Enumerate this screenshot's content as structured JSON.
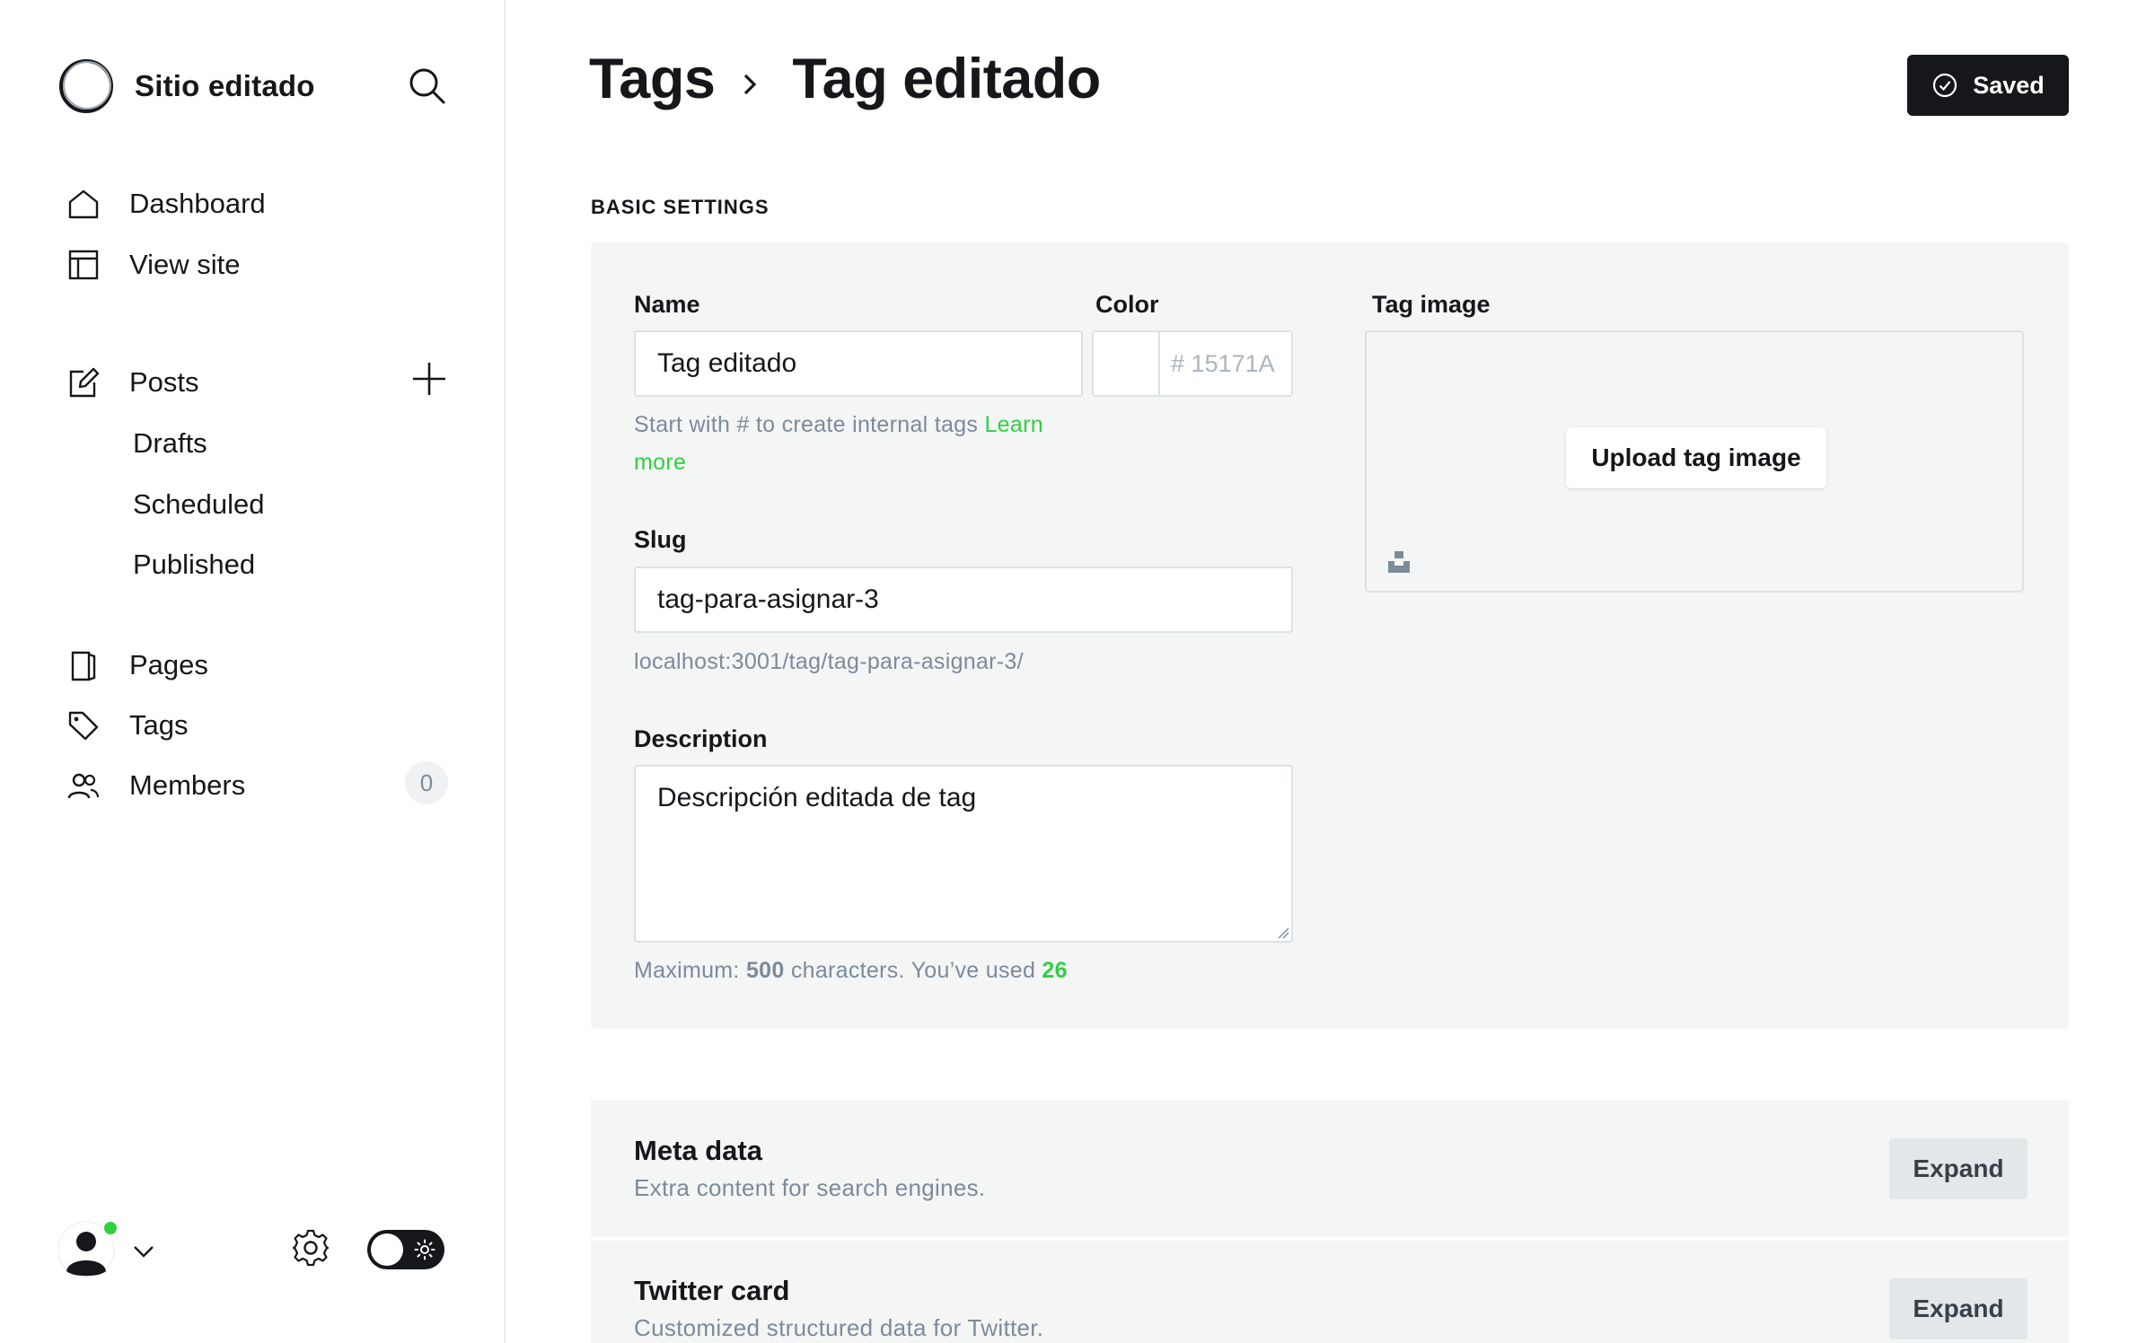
{
  "sidebar": {
    "site_title": "Sitio editado",
    "nav": {
      "dashboard": "Dashboard",
      "view_site": "View site",
      "posts": "Posts",
      "drafts": "Drafts",
      "scheduled": "Scheduled",
      "published": "Published",
      "pages": "Pages",
      "tags": "Tags",
      "members": "Members",
      "members_count": "0"
    },
    "icons": [
      "search-icon",
      "home-icon",
      "layout-icon",
      "edit-icon",
      "plus-icon",
      "page-icon",
      "tag-icon",
      "members-icon",
      "avatar-icon",
      "chevron-down-icon",
      "gear-icon",
      "sun-icon"
    ],
    "status_color": "#30cf43"
  },
  "header": {
    "breadcrumb_parent": "Tags",
    "title": "Tag editado",
    "saved_label": "Saved"
  },
  "form": {
    "section_label": "Basic settings",
    "name_label": "Name",
    "name_value": "Tag editado",
    "name_help": "Start with # to create internal tags",
    "name_help_link": "Learn more",
    "color_label": "Color",
    "color_hash": "#",
    "color_placeholder": "15171A",
    "slug_label": "Slug",
    "slug_value": "tag-para-asignar-3",
    "slug_url": "localhost:3001/tag/tag-para-asignar-3/",
    "description_label": "Description",
    "description_value": "Descripción editada de tag",
    "desc_help_prefix": "Maximum:",
    "desc_help_max": "500",
    "desc_help_middle": "characters. You’ve used",
    "desc_help_used": "26",
    "tag_image_label": "Tag image",
    "upload_label": "Upload tag image"
  },
  "sections": [
    {
      "title": "Meta data",
      "subtitle": "Extra content for search engines.",
      "button": "Expand"
    },
    {
      "title": "Twitter card",
      "subtitle": "Customized structured data for Twitter.",
      "button": "Expand"
    }
  ],
  "colors": {
    "accent_green": "#30cf43",
    "primary_dark": "#15171a",
    "muted_text": "#7c8b9a",
    "panel_bg": "#f4f5f5"
  }
}
